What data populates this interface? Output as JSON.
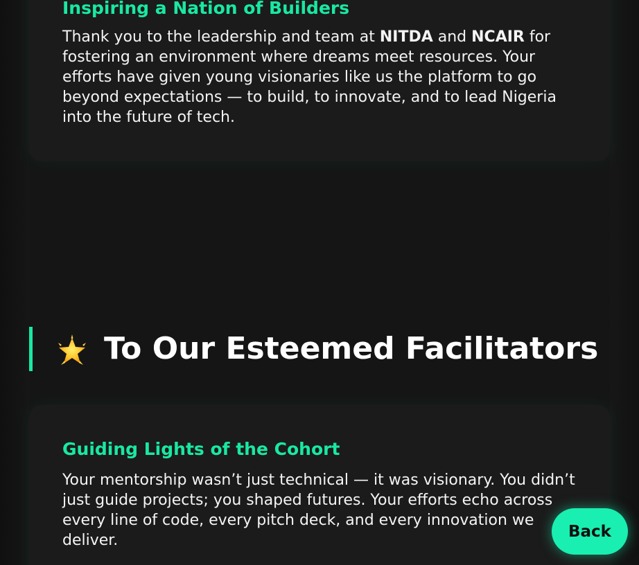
{
  "cards": [
    {
      "title": "Inspiring a Nation of Builders",
      "text_parts": [
        "Thank you to the leadership and team at ",
        "NITDA",
        " and ",
        "NCAIR",
        " for fostering an environment where dreams meet resources. Your efforts have given young visionaries like us the platform to go beyond expectations — to build, to innovate, and to lead Nigeria into the future of tech."
      ]
    },
    {
      "title": "Guiding Lights of the Cohort",
      "text": "Your mentorship wasn’t just technical — it was visionary. You didn’t just guide projects; you shaped futures. Your efforts echo across every line of code, every pitch deck, and every innovation we deliver."
    }
  ],
  "section": {
    "icon": "glowing-star-icon",
    "title": "To Our Esteemed Facilitators"
  },
  "back_button": {
    "label": "Back"
  },
  "colors": {
    "accent": "#19e8a3",
    "background": "#151515",
    "card": "#1b1b1b",
    "button": "#19efb0"
  }
}
